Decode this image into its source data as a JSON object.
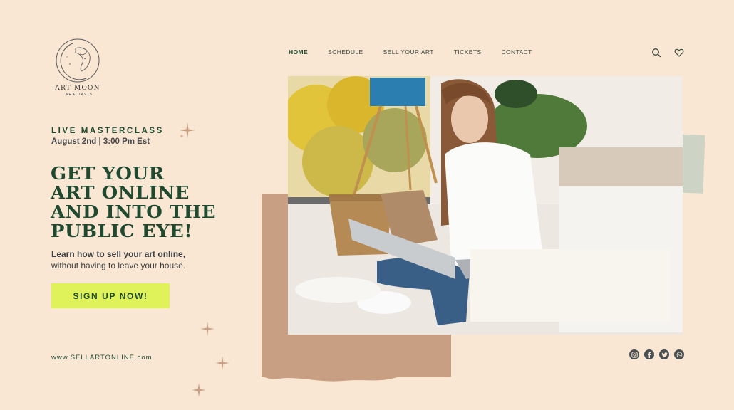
{
  "brand": {
    "name": "ART MOON",
    "subtitle": "LARA DAVIS"
  },
  "nav": {
    "items": [
      {
        "label": "HOME",
        "active": true
      },
      {
        "label": "SCHEDULE",
        "active": false
      },
      {
        "label": "SELL YOUR ART",
        "active": false
      },
      {
        "label": "TICKETS",
        "active": false
      },
      {
        "label": "CONTACT",
        "active": false
      }
    ],
    "icons": [
      "search-icon",
      "heart-icon"
    ]
  },
  "hero": {
    "eyebrow": "LIVE MASTERCLASS",
    "datetime": "August 2nd | 3:00 Pm Est",
    "headline_lines": [
      "GET YOUR",
      "ART ONLINE",
      "AND INTO THE",
      "PUBLIC EYE!"
    ],
    "lead_bold": "Learn how to sell your art online,",
    "lead_rest": "without having to leave your house.",
    "cta_label": "SIGN UP NOW!"
  },
  "footer": {
    "website": "www.SELLARTONLINE.com",
    "social": [
      "instagram-icon",
      "facebook-icon",
      "twitter-icon",
      "whatsapp-icon"
    ]
  },
  "colors": {
    "background": "#f9e6d3",
    "primary_green": "#1f4a30",
    "cta_lime": "#dff25a",
    "tan": "#c89f82",
    "sage": "#c9d2c3"
  }
}
